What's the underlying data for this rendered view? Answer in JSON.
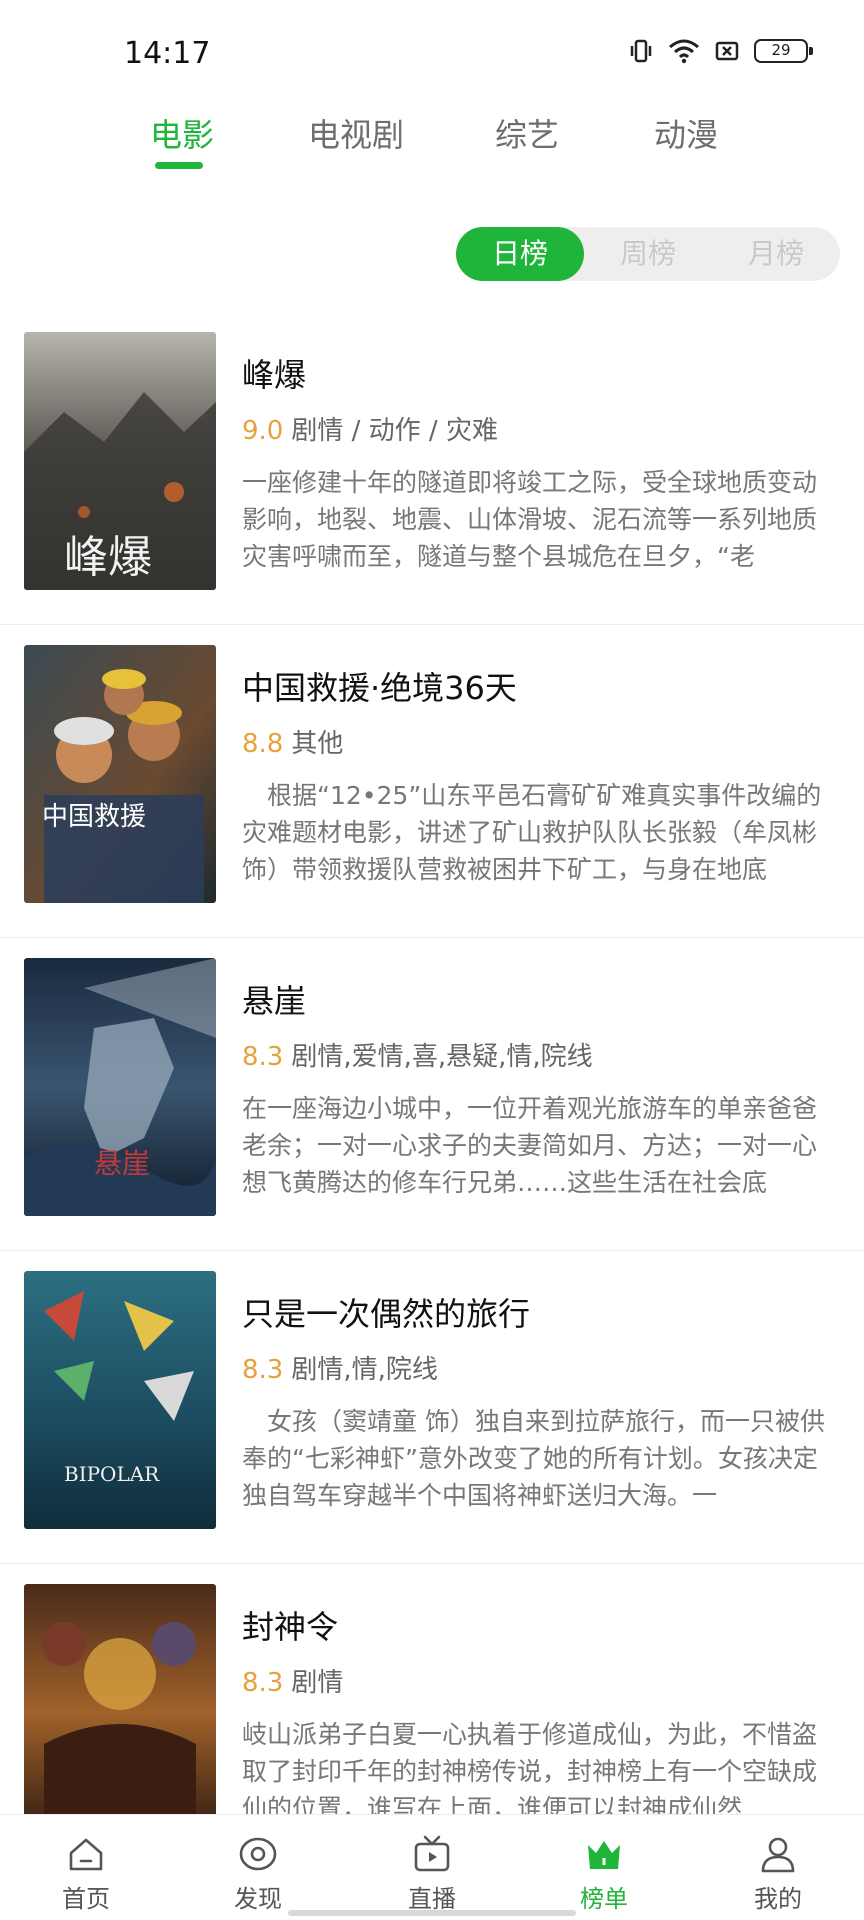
{
  "status_bar": {
    "time": "14:17",
    "battery": "29"
  },
  "category_tabs": [
    {
      "label": "电影",
      "active": true
    },
    {
      "label": "电视剧",
      "active": false
    },
    {
      "label": "综艺",
      "active": false
    },
    {
      "label": "动漫",
      "active": false
    }
  ],
  "period_tabs": [
    {
      "label": "日榜",
      "active": true
    },
    {
      "label": "周榜",
      "active": false
    },
    {
      "label": "月榜",
      "active": false
    }
  ],
  "movies": [
    {
      "title": "峰爆",
      "score": "9.0",
      "genre": "剧情 / 动作 / 灾难",
      "description": "一座修建十年的隧道即将竣工之际，受全球地质变动影响，地裂、地震、山体滑坡、泥石流等一系列地质灾害呼啸而至，隧道与整个县城危在旦夕，“老"
    },
    {
      "title": "中国救援·绝境36天",
      "score": "8.8",
      "genre": "其他",
      "description": "　根据“12•25”山东平邑石膏矿矿难真实事件改编的灾难题材电影，讲述了矿山救护队队长张毅（牟凤彬饰）带领救援队营救被困井下矿工，与身在地底"
    },
    {
      "title": "悬崖",
      "score": "8.3",
      "genre": "剧情,爱情,喜,悬疑,情,院线",
      "description": "在一座海边小城中，一位开着观光旅游车的单亲爸爸老余；一对一心求子的夫妻简如月、方达；一对一心想飞黄腾达的修车行兄弟……这些生活在社会底"
    },
    {
      "title": "只是一次偶然的旅行",
      "score": "8.3",
      "genre": "剧情,情,院线",
      "description": "　女孩（窦靖童 饰）独自来到拉萨旅行，而一只被供奉的“七彩神虾”意外改变了她的所有计划。女孩决定独自驾车穿越半个中国将神虾送归大海。一"
    },
    {
      "title": "封神令",
      "score": "8.3",
      "genre": "剧情",
      "description": "岐山派弟子白夏一心执着于修道成仙，为此，不惜盗取了封印千年的封神榜传说，封神榜上有一个空缺成仙的位置，谁写在上面，谁便可以封神成仙然"
    }
  ],
  "bottom_nav": [
    {
      "label": "首页",
      "icon": "home-icon",
      "active": false
    },
    {
      "label": "发现",
      "icon": "eye-icon",
      "active": false
    },
    {
      "label": "直播",
      "icon": "tv-icon",
      "active": false
    },
    {
      "label": "榜单",
      "icon": "crown-icon",
      "active": true
    },
    {
      "label": "我的",
      "icon": "user-icon",
      "active": false
    }
  ],
  "colors": {
    "accent": "#1fb53b",
    "score": "#e6a23c"
  }
}
